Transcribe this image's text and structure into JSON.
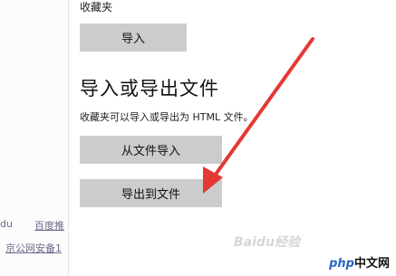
{
  "left": {
    "link1": "du",
    "link2": "百度推",
    "link3": "京公网安备1"
  },
  "panel": {
    "favorites_label": "收藏夹",
    "import_button": "导入",
    "section_title": "导入或导出文件",
    "section_desc": "收藏夹可以导入或导出为 HTML 文件。",
    "import_from_file_button": "从文件导入",
    "export_to_file_button": "导出到文件"
  },
  "watermark": "Baidu经验",
  "logo": {
    "prefix": "php",
    "suffix": "中文网"
  },
  "colors": {
    "arrow": "#e53935",
    "button_bg": "#cccccc"
  }
}
